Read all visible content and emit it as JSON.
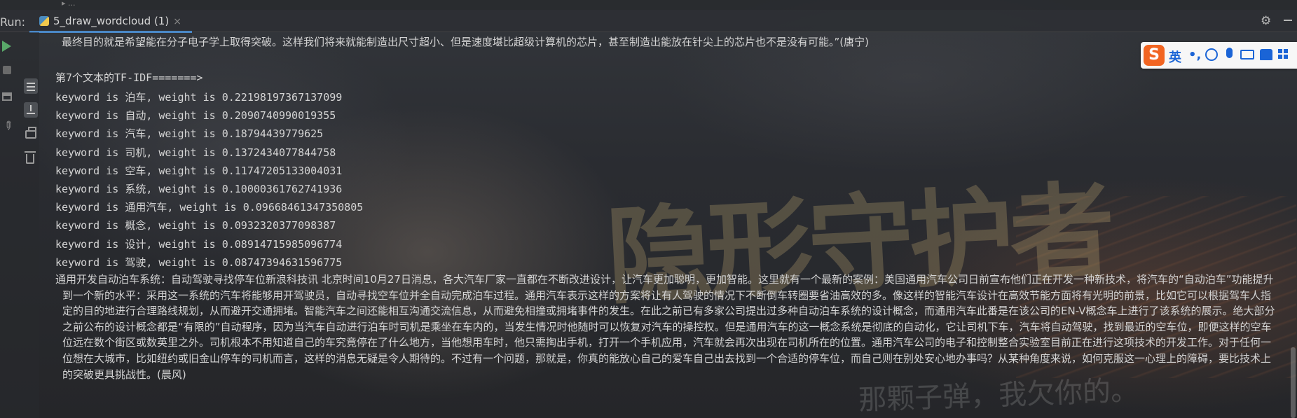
{
  "wallpaper": {
    "title_text": "隐形守护者",
    "line_text": "那颗子弹，我欠你的。"
  },
  "top_strip": {
    "ghost_text": "▸ ..."
  },
  "run_bar": {
    "label": "Run:",
    "tab_label": "5_draw_wordcloud (1)",
    "close_glyph": "×"
  },
  "console": {
    "previous_text": "最终目的就是希望能在分子电子学上取得突破。这样我们将来就能制造出尺寸超小、但是速度堪比超级计算机的芯片，甚至制造出能放在针尖上的芯片也不是没有可能。”(唐宁)",
    "header": "第7个文本的TF-IDF=======>",
    "keywords": [
      {
        "line": "keyword is 泊车, weight is 0.22198197367137099"
      },
      {
        "line": "keyword is 自动, weight is 0.2090740990019355"
      },
      {
        "line": "keyword is 汽车, weight is 0.18794439779625"
      },
      {
        "line": "keyword is 司机, weight is 0.1372434077844758"
      },
      {
        "line": "keyword is 空车, weight is 0.11747205133004031"
      },
      {
        "line": "keyword is 系统, weight is 0.10000361762741936"
      },
      {
        "line": "keyword is 通用汽车, weight is 0.09668461347350805"
      },
      {
        "line": "keyword is 概念, weight is 0.0932320377098387"
      },
      {
        "line": "keyword is 设计, weight is 0.08914715985096774"
      },
      {
        "line": "keyword is 驾驶, weight is 0.08747394631596775"
      }
    ],
    "article": "通用开发自动泊车系统：自动驾驶寻找停车位新浪科技讯 北京时间10月27日消息，各大汽车厂家一直都在不断改进设计，让汽车更加聪明，更加智能。这里就有一个最新的案例：美国通用汽车公司日前宣布他们正在开发一种新技术，将汽车的“自动泊车”功能提升到一个新的水平：采用这一系统的汽车将能够用开驾驶员，自动寻找空车位并全自动完成泊车过程。通用汽车表示这样的方案将让有人驾驶的情况下不断倒车转圈要省油高效的多。像这样的智能汽车设计在高效节能方面将有光明的前景，比如它可以根据驾车人指定的目的地进行合理路线规划，从而避开交通拥堵。智能汽车之间还能相互沟通交流信息，从而避免相撞或拥堵事件的发生。在此之前已有多家公司提出过多种自动泊车系统的设计概念，而通用汽车此番是在该公司的EN-V概念车上进行了该系统的展示。绝大部分之前公布的设计概念都是“有限的”自动程序，因为当汽车自动进行泊车时司机是乘坐在车内的，当发生情况时他随时可以恢复对汽车的操控权。但是通用汽车的这一概念系统是彻底的自动化，它让司机下车，汽车将自动驾驶，找到最近的空车位，即便这样的空车位远在数个街区或数英里之外。司机根本不用知道自己的车究竟停在了什么地方，当他想用车时，他只需掏出手机，打开一个手机应用，汽车就会再次出现在司机所在的位置。通用汽车公司的电子和控制整合实验室目前正在进行这项技术的开发工作。对于任何一位想在大城市，比如纽约或旧金山停车的司机而言，这样的消息无疑是令人期待的。不过有一个问题，那就是，你真的能放心自己的爱车自己出去找到一个合适的停车位，而自己则在别处安心地办事吗？从某种角度来说，如何克服这一心理上的障碍，要比技术上的突破更具挑战性。(晨风)"
  },
  "ime": {
    "logo": "S",
    "lang": "英",
    "punct": "•,"
  },
  "icons": {
    "run": "play-icon",
    "stop": "stop-icon",
    "settings": "gear-icon",
    "wrap": "soft-wrap-icon",
    "scroll": "scroll-to-end-icon",
    "print": "print-icon",
    "clear": "trash-icon",
    "pin": "pin-icon",
    "layout": "layout-icon"
  },
  "colors": {
    "accent": "#4a88c7",
    "run_green": "#59a869",
    "ime_orange": "#f26522",
    "ime_blue": "#1a64d6"
  }
}
